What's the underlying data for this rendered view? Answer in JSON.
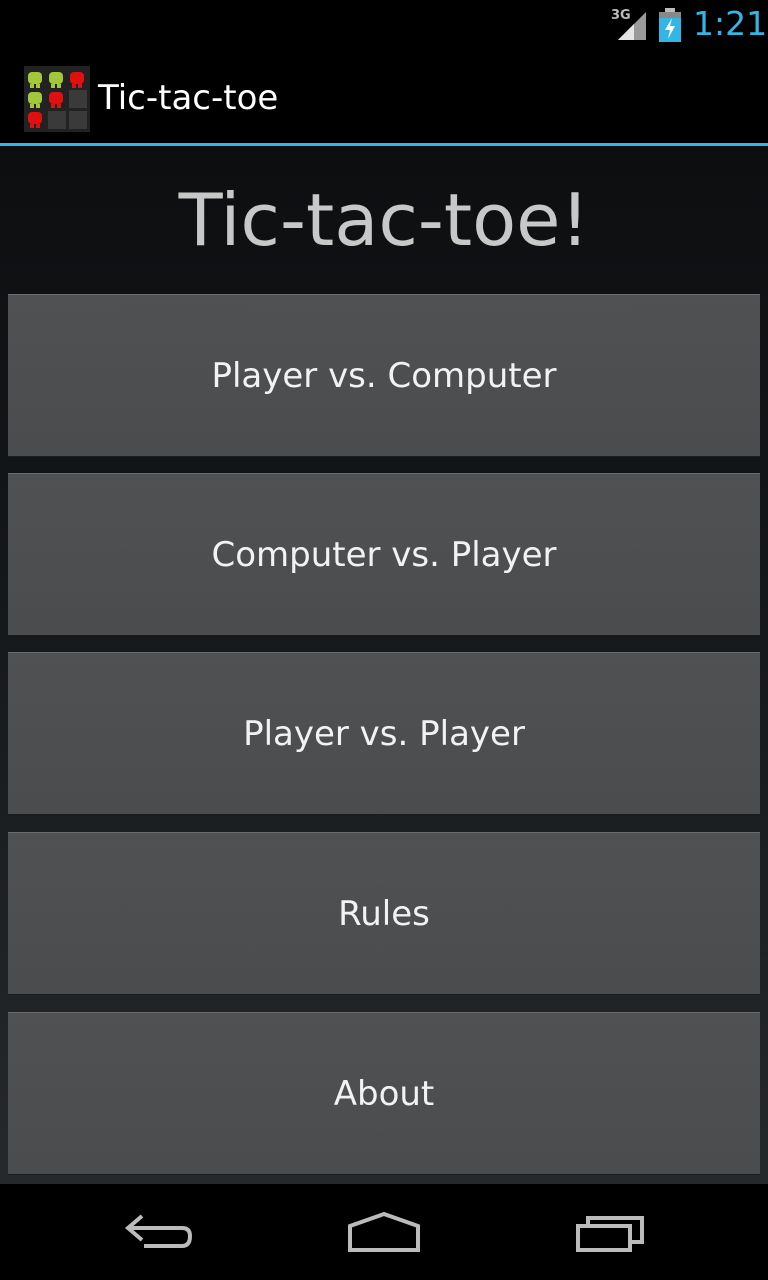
{
  "status_bar": {
    "network": "3G",
    "time": "1:21",
    "icons": [
      "signal-icon",
      "battery-charging-icon"
    ]
  },
  "action_bar": {
    "title": "Tic-tac-toe",
    "icon": "app-icon"
  },
  "main": {
    "title": "Tic-tac-toe!",
    "buttons": [
      {
        "label": "Player vs. Computer"
      },
      {
        "label": "Computer vs. Player"
      },
      {
        "label": "Player vs. Player"
      },
      {
        "label": "Rules"
      },
      {
        "label": "About"
      }
    ]
  },
  "nav_bar": {
    "icons": [
      "back-icon",
      "home-icon",
      "recent-apps-icon"
    ]
  },
  "colors": {
    "accent": "#33b5e5",
    "button_bg": "#4d4f51",
    "title_text": "#c8c8c8",
    "android_green": "#a4c639",
    "android_red": "#e01010"
  }
}
